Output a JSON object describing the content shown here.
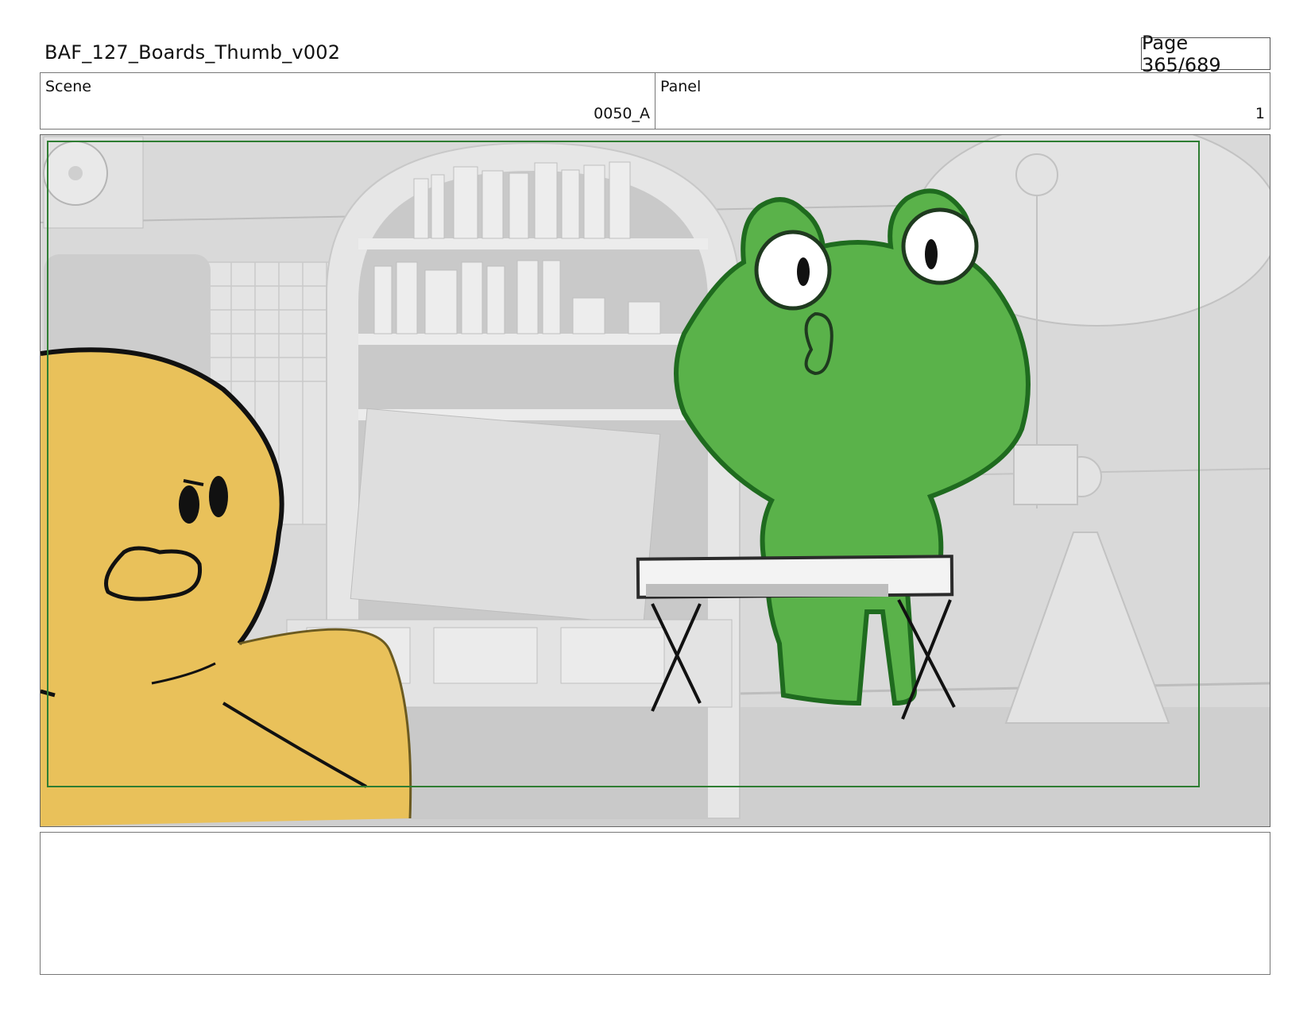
{
  "header": {
    "title": "BAF_127_Boards_Thumb_v002",
    "page_label": "Page 365/689"
  },
  "info": {
    "scene_label": "Scene",
    "scene_value": "0050_A",
    "panel_label": "Panel",
    "panel_value": "1"
  },
  "notes": {
    "text": ""
  },
  "colors": {
    "safe_frame": "#2e7d32",
    "frog_green": "#5ab24a",
    "duck_yellow": "#e9c15a",
    "background_gray": "#d9d9d9"
  }
}
